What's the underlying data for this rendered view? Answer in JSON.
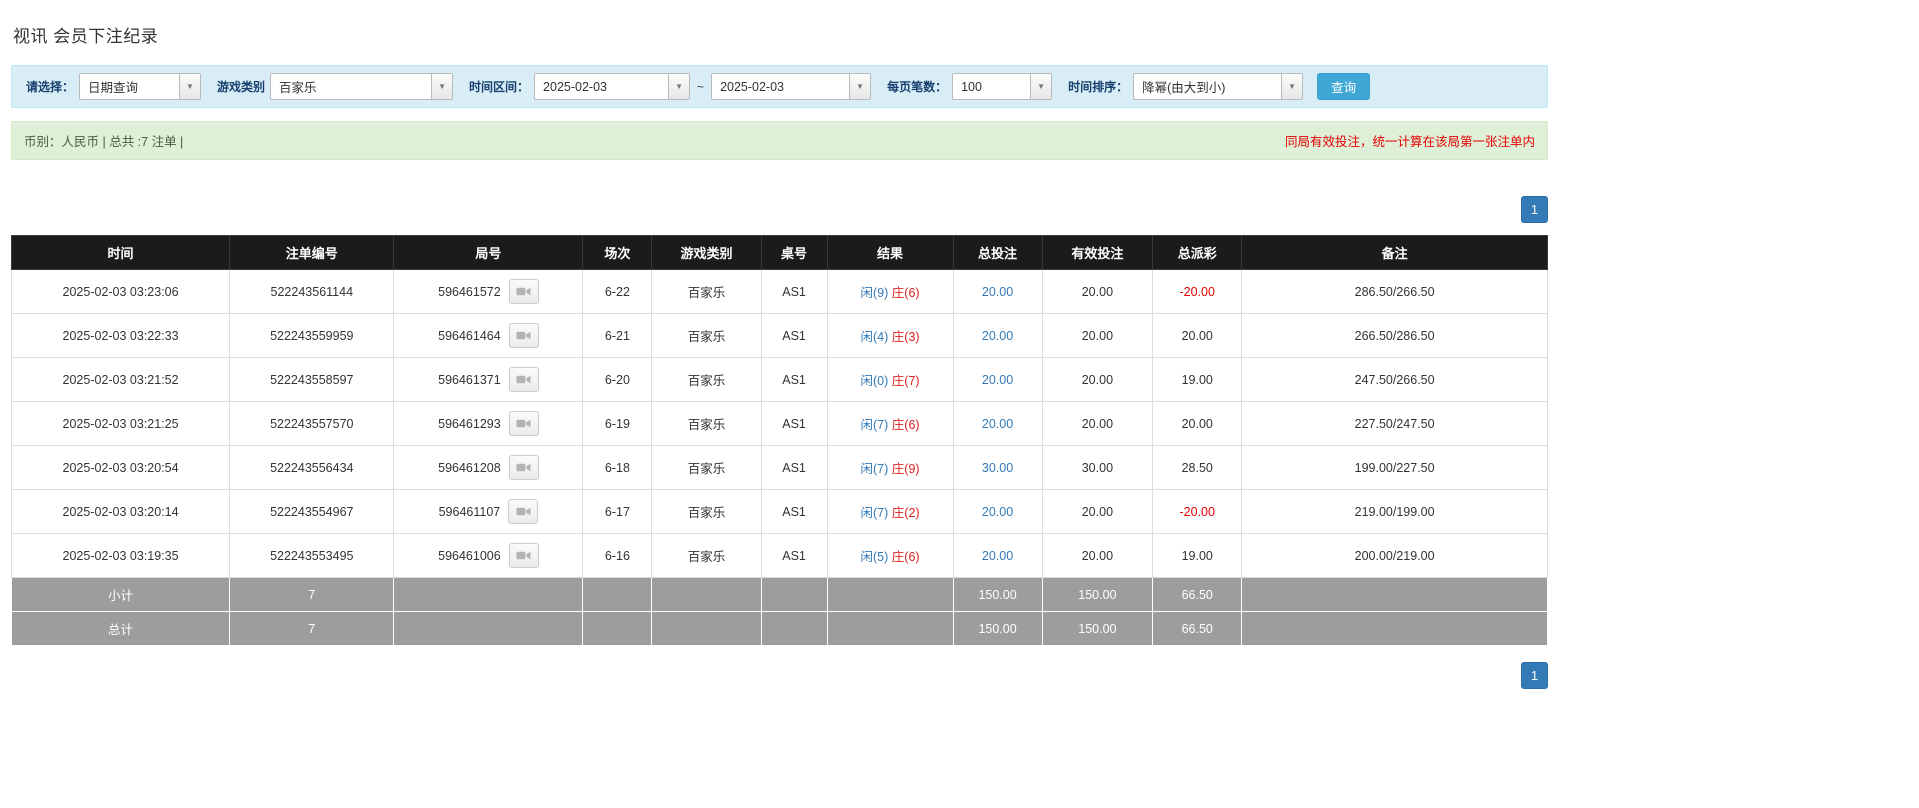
{
  "page": {
    "title": "视讯 会员下注纪录"
  },
  "filters": {
    "select_label": "请选择：",
    "select_value": "日期查询",
    "game_label": "游戏类别",
    "game_value": "百家乐",
    "range_label": "时间区间：",
    "date_from": "2025-02-03",
    "range_separator": "~",
    "date_to": "2025-02-03",
    "page_size_label": "每页笔数：",
    "page_size_value": "100",
    "sort_label": "时间排序：",
    "sort_value": "降幂(由大到小)",
    "search_label": "查询"
  },
  "summary": {
    "currency_info": "币别：人民币 | 总共 :7 注单 |",
    "notice": "同局有效投注，统一计算在该局第一张注单内"
  },
  "pagination": {
    "current_page": "1"
  },
  "table": {
    "headers": [
      "时间",
      "注单编号",
      "局号",
      "场次",
      "游戏类别",
      "桌号",
      "结果",
      "总投注",
      "有效投注",
      "总派彩",
      "备注"
    ],
    "rows": [
      {
        "time": "2025-02-03 03:23:06",
        "bet_id": "522243561144",
        "round_id": "596461572",
        "session": "6-22",
        "game": "百家乐",
        "table_no": "AS1",
        "player": "闲(9)",
        "banker": "庄(6)",
        "total_bet": "20.00",
        "valid_bet": "20.00",
        "payout": "-20.00",
        "remark": "286.50/266.50"
      },
      {
        "time": "2025-02-03 03:22:33",
        "bet_id": "522243559959",
        "round_id": "596461464",
        "session": "6-21",
        "game": "百家乐",
        "table_no": "AS1",
        "player": "闲(4)",
        "banker": "庄(3)",
        "total_bet": "20.00",
        "valid_bet": "20.00",
        "payout": "20.00",
        "remark": "266.50/286.50"
      },
      {
        "time": "2025-02-03 03:21:52",
        "bet_id": "522243558597",
        "round_id": "596461371",
        "session": "6-20",
        "game": "百家乐",
        "table_no": "AS1",
        "player": "闲(0)",
        "banker": "庄(7)",
        "total_bet": "20.00",
        "valid_bet": "20.00",
        "payout": "19.00",
        "remark": "247.50/266.50"
      },
      {
        "time": "2025-02-03 03:21:25",
        "bet_id": "522243557570",
        "round_id": "596461293",
        "session": "6-19",
        "game": "百家乐",
        "table_no": "AS1",
        "player": "闲(7)",
        "banker": "庄(6)",
        "total_bet": "20.00",
        "valid_bet": "20.00",
        "payout": "20.00",
        "remark": "227.50/247.50"
      },
      {
        "time": "2025-02-03 03:20:54",
        "bet_id": "522243556434",
        "round_id": "596461208",
        "session": "6-18",
        "game": "百家乐",
        "table_no": "AS1",
        "player": "闲(7)",
        "banker": "庄(9)",
        "total_bet": "30.00",
        "valid_bet": "30.00",
        "payout": "28.50",
        "remark": "199.00/227.50"
      },
      {
        "time": "2025-02-03 03:20:14",
        "bet_id": "522243554967",
        "round_id": "596461107",
        "session": "6-17",
        "game": "百家乐",
        "table_no": "AS1",
        "player": "闲(7)",
        "banker": "庄(2)",
        "total_bet": "20.00",
        "valid_bet": "20.00",
        "payout": "-20.00",
        "remark": "219.00/199.00"
      },
      {
        "time": "2025-02-03 03:19:35",
        "bet_id": "522243553495",
        "round_id": "596461006",
        "session": "6-16",
        "game": "百家乐",
        "table_no": "AS1",
        "player": "闲(5)",
        "banker": "庄(6)",
        "total_bet": "20.00",
        "valid_bet": "20.00",
        "payout": "19.00",
        "remark": "200.00/219.00"
      }
    ],
    "subtotal": {
      "label": "小计",
      "count": "7",
      "total_bet": "150.00",
      "valid_bet": "150.00",
      "payout": "66.50"
    },
    "grand_total": {
      "label": "总计",
      "count": "7",
      "total_bet": "150.00",
      "valid_bet": "150.00",
      "payout": "66.50"
    }
  },
  "colors": {
    "accent_blue": "#337ab7",
    "player_blue": "#337ab7",
    "banker_red": "#dd2222",
    "negative_red": "#e60000",
    "notice_red": "#e60000",
    "filter_bar_bg": "#d9edf7",
    "summary_bar_bg": "#dff0d8",
    "table_header_bg": "#1b1b1b",
    "table_footer_bg": "#9d9d9d",
    "search_button_bg": "#3fa7d6"
  }
}
